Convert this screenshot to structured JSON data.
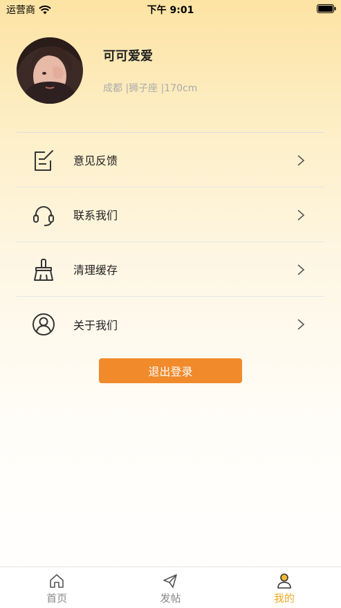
{
  "status_bar": {
    "carrier": "运营商",
    "time": "下午 9:01"
  },
  "profile": {
    "name": "可可爱爱",
    "info": "成都 |狮子座 |170cm"
  },
  "menu": [
    {
      "label": "意见反馈",
      "icon": "edit-note-icon"
    },
    {
      "label": "联系我们",
      "icon": "headset-icon"
    },
    {
      "label": "清理缓存",
      "icon": "broom-icon"
    },
    {
      "label": "关于我们",
      "icon": "user-circle-icon"
    }
  ],
  "logout_label": "退出登录",
  "tabs": [
    {
      "label": "首页",
      "icon": "home-icon"
    },
    {
      "label": "发帖",
      "icon": "paper-plane-icon"
    },
    {
      "label": "我的",
      "icon": "person-icon",
      "active": true
    }
  ],
  "colors": {
    "accent": "#f08a2b",
    "active_tab": "#f2a825"
  }
}
